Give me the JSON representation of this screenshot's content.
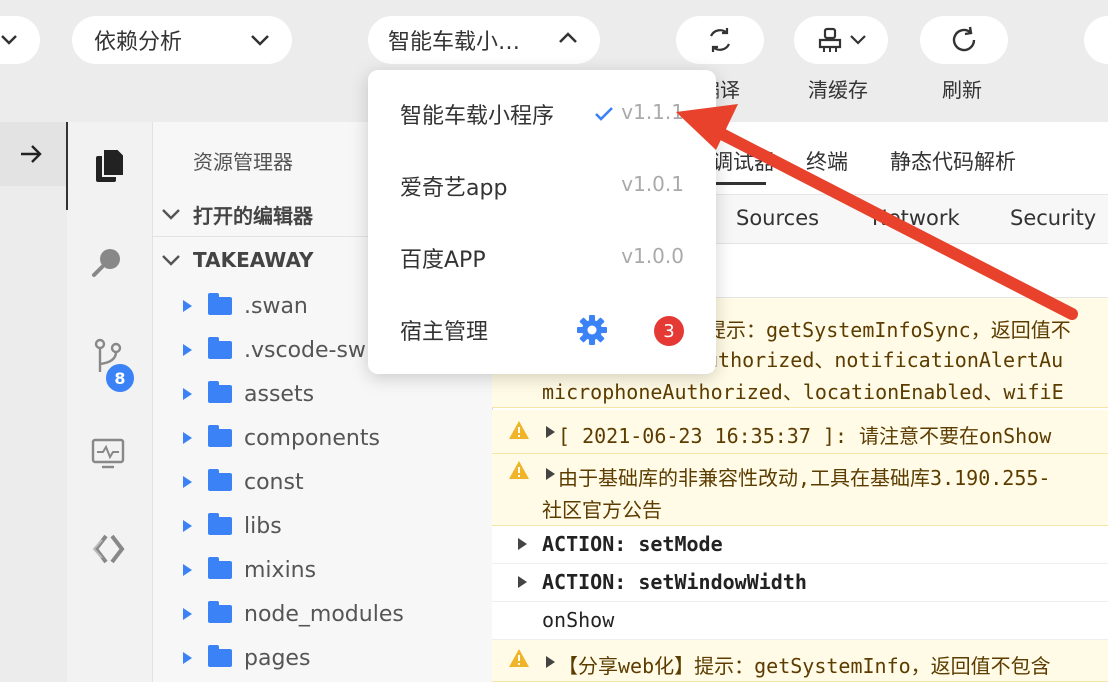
{
  "toolbar": {
    "analysis_select": "依赖分析",
    "app_select": "智能车载小…",
    "compile_label": "编译",
    "clear_cache_label": "清缓存",
    "refresh_label": "刷新"
  },
  "dropdown": {
    "items": [
      {
        "label": "智能车载小程序",
        "version": "v1.1.1",
        "selected": true
      },
      {
        "label": "爱奇艺app",
        "version": "v1.0.1"
      },
      {
        "label": "百度APP",
        "version": "v1.0.0"
      }
    ],
    "host_manage": {
      "label": "宿主管理",
      "badge": "3"
    }
  },
  "activity_bar": {
    "source_control_badge": "8"
  },
  "explorer": {
    "title": "资源管理器",
    "open_editors": "打开的编辑器",
    "project": "TAKEAWAY",
    "folders": [
      ".swan",
      ".vscode-sw",
      "assets",
      "components",
      "const",
      "libs",
      "mixins",
      "node_modules",
      "pages"
    ]
  },
  "panel": {
    "tabs": [
      "调试器",
      "终端",
      "静态代码解析"
    ],
    "devtools_tabs": [
      "Sources",
      "Network",
      "Security"
    ],
    "logs": [
      {
        "type": "warn",
        "lines": [
          "提示：getSystemInfoSync，返回值不",
          "uthorized、notificationAlertAu",
          "microphoneAuthorized、locationEnabled、wifiE"
        ]
      },
      {
        "type": "warn",
        "lines": [
          "[ 2021-06-23 16:35:37 ]: 请注意不要在onShow"
        ]
      },
      {
        "type": "warn",
        "lines": [
          "由于基础库的非兼容性改动,工具在基础库3.190.255-",
          "社区官方公告"
        ]
      },
      {
        "type": "plain",
        "lines": [
          "ACTION: setMode"
        ]
      },
      {
        "type": "plain",
        "lines": [
          "ACTION: setWindowWidth"
        ]
      },
      {
        "type": "plain",
        "lines": [
          "onShow"
        ]
      },
      {
        "type": "warn",
        "lines": [
          "【分享web化】提示：getSystemInfo，返回值不包含"
        ]
      }
    ]
  },
  "colors": {
    "accent": "#3b82f6",
    "badge_red": "#e53935",
    "arrow_red": "#e8412c"
  }
}
